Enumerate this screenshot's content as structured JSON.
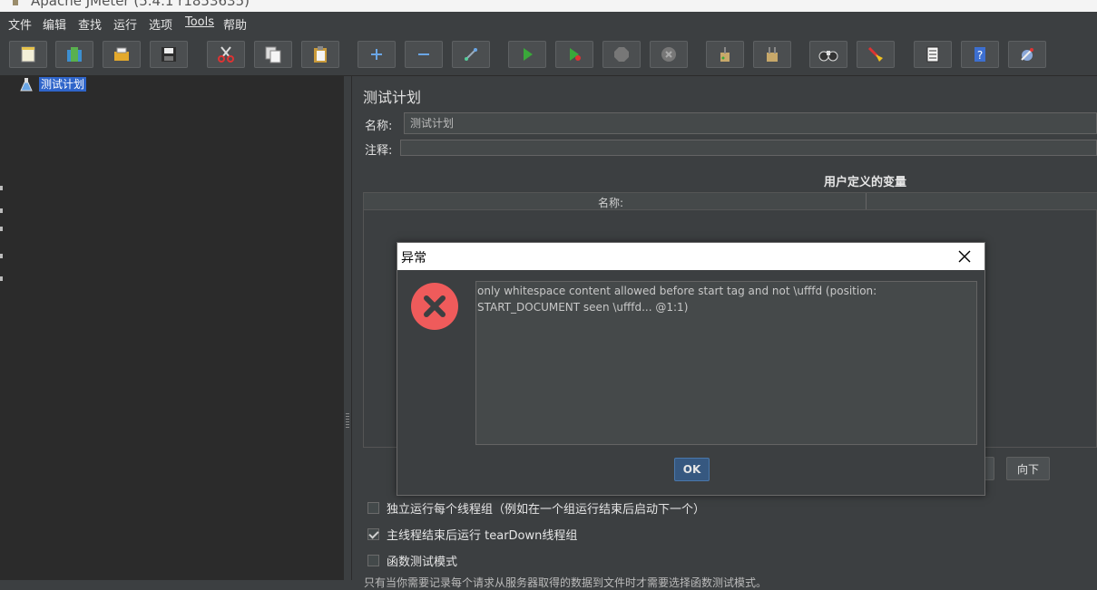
{
  "window": {
    "title": "Apache JMeter (5.4.1 r1853635)"
  },
  "menu": [
    "文件",
    "编辑",
    "查找",
    "运行",
    "选项",
    "Tools",
    "帮助"
  ],
  "toolbar": {
    "icons": [
      "new-icon",
      "templates-icon",
      "open-icon",
      "save-icon",
      "cut-icon",
      "copy-icon",
      "paste-icon",
      "expand-icon",
      "collapse-icon",
      "toggle-icon",
      "start-icon",
      "start-no-timers-icon",
      "stop-icon",
      "shutdown-icon",
      "clear-icon",
      "clear-all-icon",
      "search-icon",
      "reset-search-icon",
      "function-helper-icon",
      "help-icon",
      "remote-icon"
    ]
  },
  "tree": {
    "root_label": "测试计划"
  },
  "panel": {
    "title": "测试计划",
    "name_label": "名称:",
    "name_value": "测试计划",
    "comment_label": "注释:",
    "comment_value": "",
    "udv_title": "用户定义的变量",
    "table_col_name": "名称:",
    "down_button": "向下",
    "options": [
      {
        "label": "独立运行每个线程组（例如在一个组运行结束后启动下一个）",
        "checked": false
      },
      {
        "label": "主线程结束后运行 tearDown线程组",
        "checked": true
      },
      {
        "label": "函数测试模式",
        "checked": false
      }
    ],
    "bottom_note": "只有当你需要记录每个请求从服务器取得的数据到文件时才需要选择函数测试模式。"
  },
  "dialog": {
    "title": "异常",
    "message": "only whitespace content allowed before start tag and not \\ufffd (position: START_DOCUMENT seen \\ufffd... @1:1)",
    "ok_label": "OK",
    "error_color": "#ef5b5b"
  },
  "colors": {
    "selection": "#2f65ca",
    "ok_button": "#365880"
  }
}
